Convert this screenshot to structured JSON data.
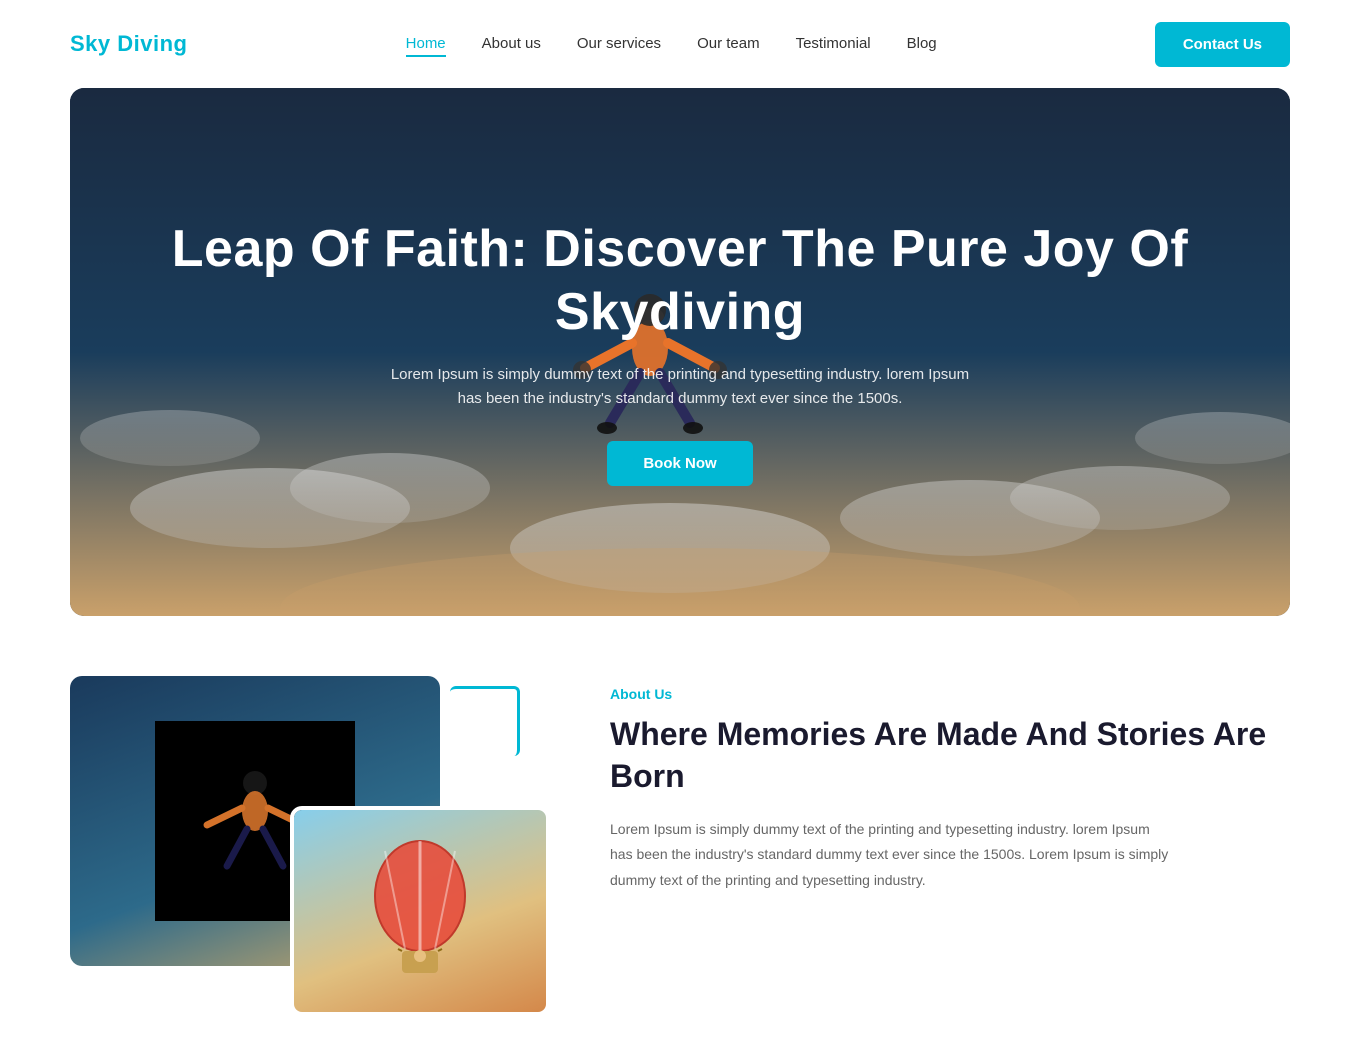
{
  "brand": {
    "logo": "Sky Diving"
  },
  "navbar": {
    "links": [
      {
        "label": "Home",
        "active": true
      },
      {
        "label": "About us",
        "active": false
      },
      {
        "label": "Our services",
        "active": false
      },
      {
        "label": "Our team",
        "active": false
      },
      {
        "label": "Testimonial",
        "active": false
      },
      {
        "label": "Blog",
        "active": false
      }
    ],
    "contact_button": "Contact Us"
  },
  "hero": {
    "title": "Leap Of Faith: Discover The Pure Joy Of Skydiving",
    "description": "Lorem Ipsum is simply dummy text of the printing and typesetting industry. lorem Ipsum has been the industry's standard dummy text ever since the 1500s.",
    "cta_button": "Book Now"
  },
  "about": {
    "tag": "About Us",
    "heading": "Where Memories Are Made And Stories Are Born",
    "description": "Lorem Ipsum is simply dummy text of the printing and typesetting industry. lorem Ipsum has been the industry's standard dummy text ever since the 1500s. Lorem Ipsum is simply dummy text of the printing and typesetting industry."
  }
}
